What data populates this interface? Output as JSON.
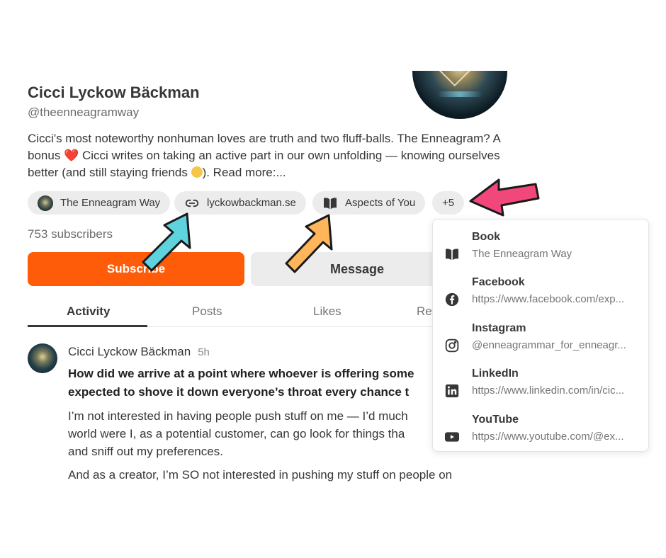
{
  "profile": {
    "name": "Cicci Lyckow Bäckman",
    "handle": "@theenneagramway",
    "bio_part1": "Cicci's most noteworthy nonhuman loves are truth and two fluff-balls. The Enneagram? A bonus ",
    "bio_heart": "❤️",
    "bio_part2": " Cicci writes on taking an active part in our own unfolding — knowing ourselves better (and still staying friends ",
    "bio_part3": "). Read more:...",
    "subscribers": "753 subscribers"
  },
  "chips": [
    {
      "label": "The Enneagram Way",
      "icon": "avatar"
    },
    {
      "label": "lyckowbackman.se",
      "icon": "link-icon"
    },
    {
      "label": "Aspects of You",
      "icon": "book-icon"
    },
    {
      "label": "+5"
    }
  ],
  "buttons": {
    "subscribe": "Subscribe",
    "message": "Message"
  },
  "tabs": [
    "Activity",
    "Posts",
    "Likes",
    "Re"
  ],
  "post": {
    "author": "Cicci Lyckow Bäckman",
    "time": "5h",
    "title": "How did we arrive at a point where whoever is offering some\nexpected to shove it down everyone’s throat every chance t",
    "p1": "I’m not interested in having people push stuff on me — I’d much\nworld were I, as a potential customer, can go look for things tha\nand sniff out my preferences.",
    "p2": "And as a creator, I’m SO not interested in pushing my stuff on people on"
  },
  "dropdown": [
    {
      "title": "Book",
      "sub": "The Enneagram Way",
      "icon": "book-icon"
    },
    {
      "title": "Facebook",
      "sub": "https://www.facebook.com/exp...",
      "icon": "facebook-icon"
    },
    {
      "title": "Instagram",
      "sub": "@enneagrammar_for_enneagr...",
      "icon": "instagram-icon"
    },
    {
      "title": "LinkedIn",
      "sub": "https://www.linkedin.com/in/cic...",
      "icon": "linkedin-icon"
    },
    {
      "title": "YouTube",
      "sub": "https://www.youtube.com/@ex...",
      "icon": "youtube-icon"
    }
  ],
  "colors": {
    "accent": "#ff5c0a",
    "arrow_cyan": "#5fd3dd",
    "arrow_orange": "#ffb55a",
    "arrow_pink": "#f2477a"
  }
}
